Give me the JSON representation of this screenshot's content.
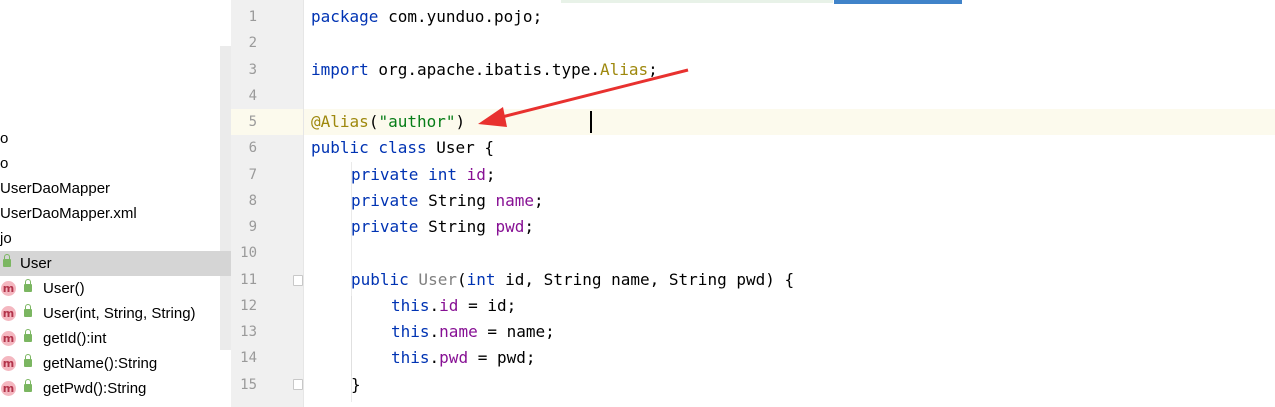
{
  "sidebar": {
    "rows": [
      {
        "label": "o"
      },
      {
        "label": "o"
      },
      {
        "label": "UserDaoMapper"
      },
      {
        "label": "UserDaoMapper.xml"
      },
      {
        "label": "jo"
      },
      {
        "label": "User"
      },
      {
        "label": "User()",
        "badge": "m"
      },
      {
        "label": "User(int, String, String)",
        "badge": "m"
      },
      {
        "label": "getId():int",
        "badge": "m"
      },
      {
        "label": "getName():String",
        "badge": "m"
      },
      {
        "label": "getPwd():String",
        "badge": "m"
      }
    ]
  },
  "editor": {
    "line_numbers": [
      "1",
      "2",
      "3",
      "4",
      "5",
      "6",
      "7",
      "8",
      "9",
      "10",
      "11",
      "12",
      "13",
      "14",
      "15"
    ],
    "code": {
      "l1_kw": "package",
      "l1_rest": " com.yunduo.pojo;",
      "l3_kw": "import",
      "l3_pkg": " org.apache.ibatis.type.",
      "l3_ann": "Alias",
      "l3_end": ";",
      "l5_ann_a": "@Alia",
      "l5_ann_b": "s",
      "l5_open": "(",
      "l5_str": "\"author\"",
      "l5_close": ")",
      "l6_kw": "public class",
      "l6_rest": " User {",
      "l7_kw": "private int",
      "l7_fld": "id",
      "l7_end": ";",
      "l8_kw": "private",
      "l8_type": " String ",
      "l8_fld": "name",
      "l8_end": ";",
      "l9_kw": "private",
      "l9_type": " String ",
      "l9_fld": "pwd",
      "l9_end": ";",
      "l11_kw": "public",
      "l11_name": " User",
      "l11_open": "(",
      "l11_kw2": "int",
      "l11_rest": " id, String name, String pwd) {",
      "l12_kw": "this",
      "l12_dot": ".",
      "l12_fld": "id",
      "l12_rest": " = id;",
      "l13_kw": "this",
      "l13_dot": ".",
      "l13_fld": "name",
      "l13_rest": " = name;",
      "l14_kw": "this",
      "l14_dot": ".",
      "l14_fld": "pwd",
      "l14_rest": " = pwd;",
      "l15": "}"
    }
  },
  "colors": {
    "keyword": "#0033b3",
    "annotation": "#9e880d",
    "string": "#067d17",
    "field": "#871094",
    "arrow": "#e8312f",
    "selected_row": "#d5d5d5"
  }
}
